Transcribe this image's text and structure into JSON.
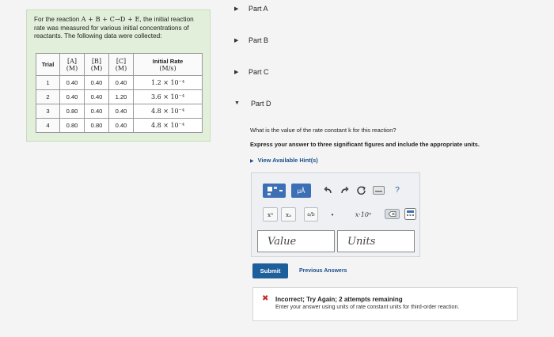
{
  "problem": {
    "intro_1": "For the reaction ",
    "reaction": "A + B + C→D + E",
    "intro_2": ", the initial reaction rate was measured for various initial concentrations of reactants. The following data were collected:",
    "table": {
      "headers": {
        "trial": "Trial",
        "a": "[A]",
        "a_unit": "(M)",
        "b": "[B]",
        "b_unit": "(M)",
        "c": "[C]",
        "c_unit": "(M)",
        "rate": "Initial Rate",
        "rate_unit": "(M/s)"
      },
      "rows": [
        {
          "trial": "1",
          "a": "0.40",
          "b": "0.40",
          "c": "0.40",
          "rate": "1.2 × 10⁻⁴"
        },
        {
          "trial": "2",
          "a": "0.40",
          "b": "0.40",
          "c": "1.20",
          "rate": "3.6 × 10⁻⁴"
        },
        {
          "trial": "3",
          "a": "0.80",
          "b": "0.40",
          "c": "0.40",
          "rate": "4.8 × 10⁻⁴"
        },
        {
          "trial": "4",
          "a": "0.80",
          "b": "0.80",
          "c": "0.40",
          "rate": "4.8 × 10⁻⁴"
        }
      ]
    }
  },
  "parts": [
    {
      "label": "Part A",
      "expanded": false
    },
    {
      "label": "Part B",
      "expanded": false
    },
    {
      "label": "Part C",
      "expanded": false
    },
    {
      "label": "Part D",
      "expanded": true
    }
  ],
  "part_d": {
    "question": "What is the value of the rate constant k for this reaction?",
    "instruction": "Express your answer to three significant figures and include the appropriate units.",
    "hints_link": "View Available Hint(s)",
    "toolbar": {
      "mu_label": "μÅ",
      "help_label": "?",
      "superscript_label": "xᵃ",
      "subscript_label": "xₐ",
      "fraction_label": "a/b",
      "dot_label": "•",
      "sci_label": "x·10ⁿ"
    },
    "value_placeholder": "Value",
    "units_placeholder": "Units",
    "submit_label": "Submit",
    "previous_answers_label": "Previous Answers",
    "feedback": {
      "title": "Incorrect; Try Again; 2 attempts remaining",
      "message": "Enter your answer using units of rate constant units for third-order reaction."
    }
  },
  "colors": {
    "problem_bg": "#e2efda",
    "accent_blue": "#3d6fb4",
    "submit_blue": "#1d5f9b",
    "error_red": "#c3272b"
  }
}
